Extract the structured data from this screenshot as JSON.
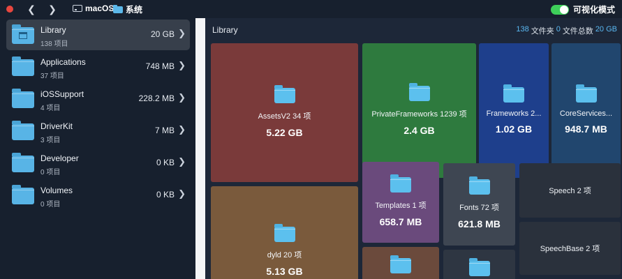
{
  "toolbar": {
    "breadcrumb": [
      "macOS",
      "系统"
    ],
    "back_icon": "chevron-left-icon",
    "forward_icon": "chevron-right-icon",
    "toggle_label": "可视化模式",
    "toggle_on": true,
    "toggle_color": "#3ecf5a"
  },
  "sidebar": {
    "items": [
      {
        "name": "Library",
        "count": "138 项目",
        "size": "20 GB"
      },
      {
        "name": "Applications",
        "count": "37 项目",
        "size": "748 MB"
      },
      {
        "name": "iOSSupport",
        "count": "4 项目",
        "size": "228.2 MB"
      },
      {
        "name": "DriverKit",
        "count": "3 项目",
        "size": "7 MB"
      },
      {
        "name": "Developer",
        "count": "0 项目",
        "size": "0 KB"
      },
      {
        "name": "Volumes",
        "count": "0 项目",
        "size": "0 KB"
      }
    ]
  },
  "main": {
    "title": "Library",
    "stats": {
      "folders": "138",
      "folders_label": "文件夹",
      "files": "0",
      "files_label": "文件总数",
      "total": "20 GB"
    },
    "tiles": [
      {
        "name": "AssetsV2 34 项",
        "size": "5.22 GB",
        "color": "#7a3a3a"
      },
      {
        "name": "PrivateFrameworks 1239 项",
        "size": "2.4 GB",
        "color": "#2e7a3e"
      },
      {
        "name": "Frameworks 2...",
        "size": "1.02 GB",
        "color": "#1e3f8c"
      },
      {
        "name": "CoreServices...",
        "size": "948.7 MB",
        "color": "#21466e"
      },
      {
        "name": "dyld 20 项",
        "size": "5.13 GB",
        "color": "#7a5a3c"
      },
      {
        "name": "Templates 1 项",
        "size": "658.7 MB",
        "color": "#6a4a7c"
      },
      {
        "name": "Fonts 72 项",
        "size": "621.8 MB",
        "color": "#3e4652"
      },
      {
        "name": "Speech 2 项",
        "size": "",
        "color": "#2a313c"
      },
      {
        "name": "SpeechBase 2 项",
        "size": "",
        "color": "#2a313c"
      }
    ]
  }
}
